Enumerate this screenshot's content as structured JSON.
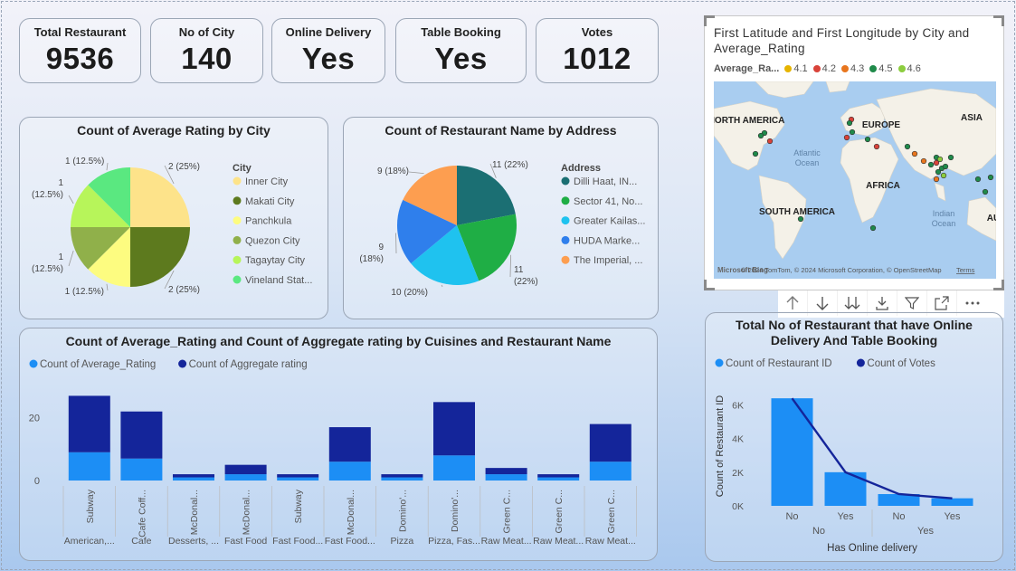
{
  "kpis": [
    {
      "label": "Total Restaurant",
      "value": "9536"
    },
    {
      "label": "No of City",
      "value": "140"
    },
    {
      "label": "Online Delivery",
      "value": "Yes"
    },
    {
      "label": "Table Booking",
      "value": "Yes"
    },
    {
      "label": "Votes",
      "value": "1012"
    }
  ],
  "pie1": {
    "title": "Count of Average Rating by City",
    "legend_title": "City"
  },
  "pie2": {
    "title": "Count of Restaurant Name by Address",
    "legend_title": "Address"
  },
  "bar": {
    "title": "Count of Average_Rating and Count of Aggregate rating by Cuisines and Restaurant Name"
  },
  "combo": {
    "title_line1": "Total No of Restaurant that have Online",
    "title_line2": "Delivery And Table Booking",
    "xlabel": "Has Online delivery",
    "ylabel": "Count of Restaurant ID"
  },
  "map": {
    "title_line1": "First Latitude and First Longitude by City and",
    "title_line2": "Average_Rating",
    "legend_title": "Average_Ra...",
    "legend": [
      {
        "label": "4.1",
        "color": "#e6b400"
      },
      {
        "label": "4.2",
        "color": "#d9433a"
      },
      {
        "label": "4.3",
        "color": "#e8761e"
      },
      {
        "label": "4.5",
        "color": "#1f8a4a"
      },
      {
        "label": "4.6",
        "color": "#8ccd3f"
      }
    ],
    "region_labels": [
      "NORTH AMERICA",
      "EUROPE",
      "ASIA",
      "AFRICA",
      "SOUTH AMERICA",
      "Atlantic",
      "Ocean",
      "Indian",
      "Ocean",
      "AU"
    ],
    "attribution": "© 2024 TomTom, © 2024 Microsoft Corporation, © OpenStreetMap",
    "terms": "Terms",
    "brand": "Microsoft Bing"
  },
  "toolbar": [
    "arrow-up-icon",
    "arrow-down-icon",
    "double-arrow-down-icon",
    "expand-hierarchy-icon",
    "filter-icon",
    "focus-mode-icon",
    "more-options-icon"
  ],
  "chart_data": [
    {
      "type": "pie",
      "title": "Count of Average Rating by City",
      "legend_title": "City",
      "categories": [
        "Inner City",
        "Makati City",
        "Panchkula",
        "Quezon City",
        "Tagaytay City",
        "Vineland Stat..."
      ],
      "values": [
        2,
        2,
        1,
        1,
        1,
        1
      ],
      "labels": [
        "2 (25%)",
        "2 (25%)",
        "1 (12.5%)",
        "1 (12.5%)",
        "1 (12.5%)",
        "1 (12.5%)"
      ],
      "colors": [
        "#fde38a",
        "#5d7a1e",
        "#fdfc80",
        "#90b04a",
        "#b7f55a",
        "#5ae880"
      ]
    },
    {
      "type": "pie",
      "title": "Count of Restaurant Name by Address",
      "legend_title": "Address",
      "categories": [
        "Dilli Haat, IN...",
        "Sector 41, No...",
        "Greater Kailas...",
        "HUDA Marke...",
        "The Imperial, ..."
      ],
      "values": [
        11,
        11,
        10,
        9,
        9
      ],
      "labels": [
        "11 (22%)",
        "11 (22%)",
        "10 (20%)",
        "9 (18%)",
        "9 (18%)"
      ],
      "colors": [
        "#1b6f73",
        "#1fae45",
        "#1fc2ef",
        "#2f7fec",
        "#fd9e50"
      ]
    },
    {
      "type": "bar",
      "stacked": true,
      "title": "Count of Average_Rating and Count of Aggregate rating by Cuisines and Restaurant Name",
      "categories": [
        {
          "name": "Subway",
          "group": "American,..."
        },
        {
          "name": "Cafe Coff...",
          "group": "Cafe"
        },
        {
          "name": "McDonal...",
          "group": "Desserts, ..."
        },
        {
          "name": "McDonal...",
          "group": "Fast Food"
        },
        {
          "name": "Subway",
          "group": "Fast Food..."
        },
        {
          "name": "McDonal...",
          "group": "Fast Food..."
        },
        {
          "name": "Domino'...",
          "group": "Pizza"
        },
        {
          "name": "Domino'...",
          "group": "Pizza, Fas..."
        },
        {
          "name": "Green C...",
          "group": "Raw Meat..."
        },
        {
          "name": "Green C...",
          "group": "Raw Meat..."
        },
        {
          "name": "Green C...",
          "group": "Raw Meat..."
        }
      ],
      "series": [
        {
          "name": "Count of Average_Rating",
          "color": "#1c8ef5",
          "values": [
            9,
            7,
            1,
            2,
            1,
            6,
            1,
            8,
            2,
            1,
            6
          ]
        },
        {
          "name": "Count of Aggregate rating",
          "color": "#14259a",
          "values": [
            18,
            15,
            1,
            3,
            1,
            11,
            1,
            17,
            2,
            1,
            12
          ]
        }
      ],
      "yticks": [
        0,
        20
      ],
      "ylim": [
        0,
        30
      ]
    },
    {
      "type": "bar",
      "combo_line": true,
      "title": "Total No of Restaurant that have Online Delivery And Table Booking",
      "xlabel": "Has Online delivery",
      "ylabel": "Count of Restaurant ID",
      "categories": [
        {
          "name": "No",
          "group": "No"
        },
        {
          "name": "Yes",
          "group": "No"
        },
        {
          "name": "No",
          "group": "Yes"
        },
        {
          "name": "Yes",
          "group": "Yes"
        }
      ],
      "series": [
        {
          "name": "Count of Restaurant ID",
          "color": "#1c8ef5",
          "type": "bar",
          "values": [
            6400,
            2000,
            700,
            450
          ]
        },
        {
          "name": "Count of Votes",
          "color": "#14259a",
          "type": "line",
          "values": [
            6400,
            2000,
            700,
            450
          ]
        }
      ],
      "yticks": [
        "0K",
        "2K",
        "4K",
        "6K"
      ],
      "ylim": [
        0,
        7000
      ]
    }
  ]
}
